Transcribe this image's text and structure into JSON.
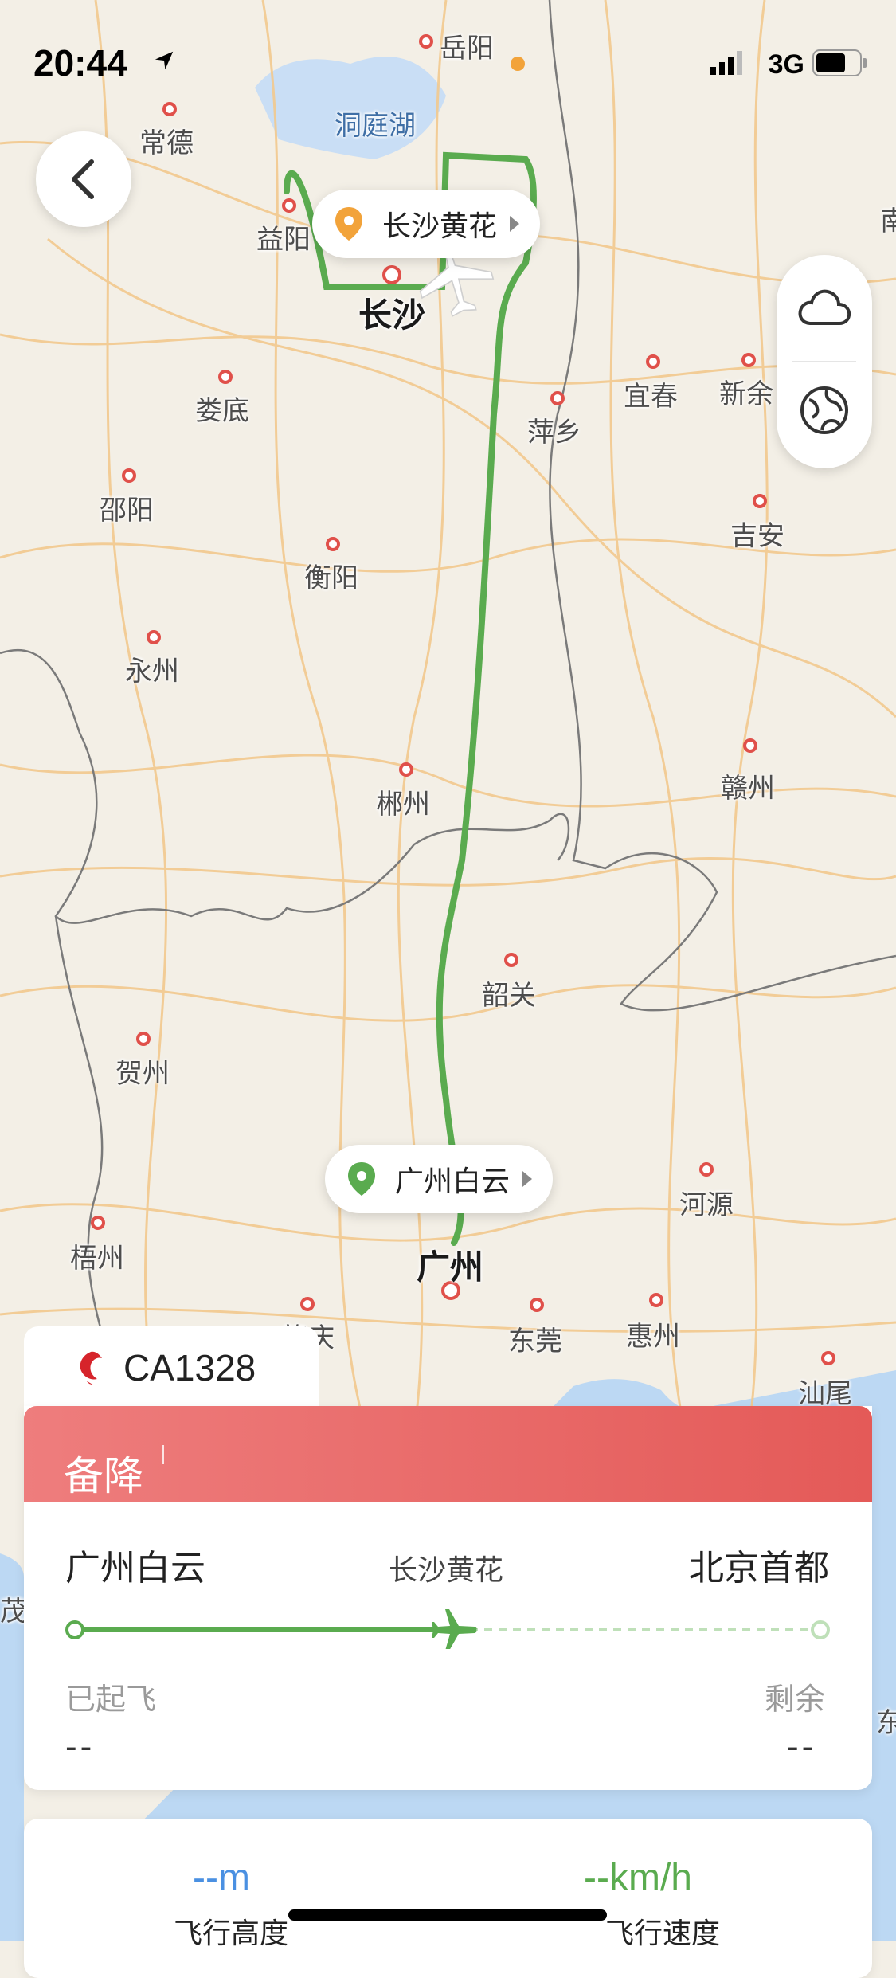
{
  "status_bar": {
    "time": "20:44",
    "network": "3G"
  },
  "map": {
    "cities": [
      "岳阳",
      "洞庭湖",
      "常德",
      "益阳",
      "长沙",
      "娄底",
      "宜春",
      "新余",
      "萍乡",
      "邵阳",
      "衡阳",
      "吉安",
      "永州",
      "郴州",
      "赣州",
      "韶关",
      "贺州",
      "河源",
      "梧州",
      "广州",
      "肇庆",
      "东莞",
      "惠州",
      "汕尾",
      "茂",
      "东",
      "南"
    ]
  },
  "markers": {
    "departure_pin": "长沙黄花",
    "arrival_pin": "广州白云"
  },
  "flight_card": {
    "flight_number": "CA1328",
    "status": "备降",
    "origin": "广州白云",
    "alternate": "长沙黄花",
    "destination": "北京首都",
    "elapsed_label": "已起飞",
    "elapsed_value": "--",
    "remaining_label": "剩余",
    "remaining_value": "--"
  },
  "metrics": {
    "altitude_value": "--m",
    "altitude_label": "飞行高度",
    "speed_value": "--km/h",
    "speed_label": "飞行速度"
  },
  "colors": {
    "route": "#5aab4f",
    "status_banner": "#e76563",
    "accent_blue": "#4a90e2",
    "pin_orange": "#f2a33a",
    "pin_green": "#5aab4f"
  },
  "icons": [
    "location-arrow-icon",
    "signal-icon",
    "battery-icon",
    "back-chevron-icon",
    "pin-icon",
    "cloud-icon",
    "globe-icon",
    "plane-icon",
    "airline-logo-icon"
  ]
}
